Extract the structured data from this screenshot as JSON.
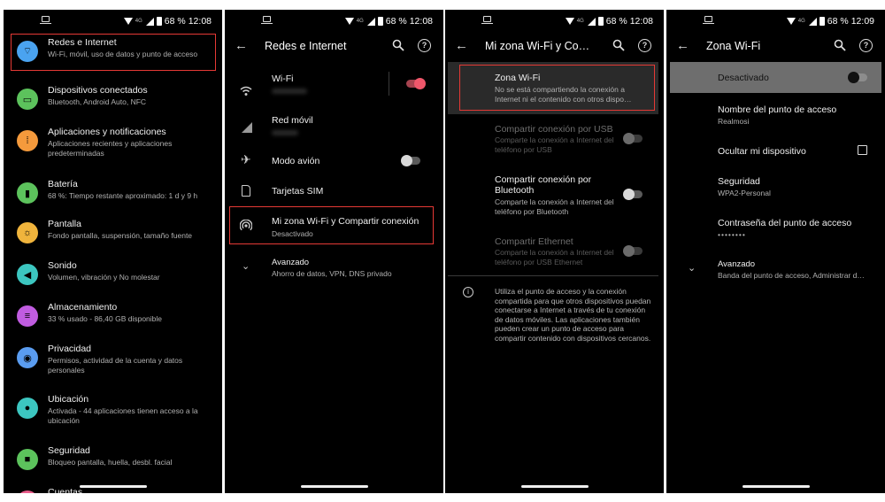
{
  "status": {
    "network": "4G",
    "battery": "68 %",
    "times": [
      "12:08",
      "12:08",
      "12:08",
      "12:09"
    ]
  },
  "screen1": {
    "items": [
      {
        "title": "Redes e Internet",
        "sub": "Wi-Fi, móvil, uso de datos y punto de acceso",
        "color": "#4aa3f0",
        "icon": "wifi-icon"
      },
      {
        "title": "Dispositivos conectados",
        "sub": "Bluetooth, Android Auto, NFC",
        "color": "#5cc25c",
        "icon": "devices-icon"
      },
      {
        "title": "Aplicaciones y notificaciones",
        "sub": "Aplicaciones recientes y aplicaciones predeterminadas",
        "color": "#f59a3c",
        "icon": "apps-icon"
      },
      {
        "title": "Batería",
        "sub": "68 %: Tiempo restante aproximado: 1 d y 9 h",
        "color": "#5cc25c",
        "icon": "battery-icon"
      },
      {
        "title": "Pantalla",
        "sub": "Fondo pantalla, suspensión, tamaño fuente",
        "color": "#f0b43c",
        "icon": "display-icon"
      },
      {
        "title": "Sonido",
        "sub": "Volumen, vibración y No molestar",
        "color": "#3cc6c0",
        "icon": "sound-icon"
      },
      {
        "title": "Almacenamiento",
        "sub": "33 % usado - 86,40 GB disponible",
        "color": "#c05ce0",
        "icon": "storage-icon"
      },
      {
        "title": "Privacidad",
        "sub": "Permisos, actividad de la cuenta y datos personales",
        "color": "#5a9cf0",
        "icon": "privacy-icon"
      },
      {
        "title": "Ubicación",
        "sub": "Activada - 44 aplicaciones tienen acceso a la ubicación",
        "color": "#3cc6c0",
        "icon": "location-icon"
      },
      {
        "title": "Seguridad",
        "sub": "Bloqueo pantalla, huella, desbl. facial",
        "color": "#5cc25c",
        "icon": "lock-icon"
      },
      {
        "title": "Cuentas",
        "sub": "",
        "color": "#e85c8a",
        "icon": "accounts-icon"
      }
    ]
  },
  "screen2": {
    "title": "Redes e Internet",
    "wifi": "Wi-Fi",
    "wifi_on": true,
    "mobile": "Red móvil",
    "airplane": "Modo avión",
    "sim": "Tarjetas SIM",
    "hotspot_title": "Mi zona Wi-Fi y Compartir conexión",
    "hotspot_sub": "Desactivado",
    "advanced_title": "Avanzado",
    "advanced_sub": "Ahorro de datos, VPN, DNS privado"
  },
  "screen3": {
    "title": "Mi zona Wi-Fi y Co…",
    "zone_title": "Zona Wi-Fi",
    "zone_sub": "No se está compartiendo la conexión a Internet ni el contenido con otros dispo…",
    "usb_title": "Compartir conexión por USB",
    "usb_sub": "Comparte la conexión a Internet del teléfono por USB",
    "bt_title": "Compartir conexión por Bluetooth",
    "bt_sub": "Comparte la conexión a Internet del teléfono por Bluetooth",
    "eth_title": "Compartir Ethernet",
    "eth_sub": "Comparte la conexión a Internet del teléfono por USB Ethernet",
    "info": "Utiliza el punto de acceso y la conexión compartida para que otros dispositivos puedan conectarse a Internet a través de tu conexión de datos móviles. Las aplicaciones también pueden crear un punto de acceso para compartir contenido con dispositivos cercanos."
  },
  "screen4": {
    "title": "Zona Wi-Fi",
    "state": "Desactivado",
    "name_title": "Nombre del punto de acceso",
    "name_value": "Realmosi",
    "hide": "Ocultar mi dispositivo",
    "security_title": "Seguridad",
    "security_value": "WPA2-Personal",
    "password_title": "Contraseña del punto de acceso",
    "password_value": "••••••••",
    "advanced_title": "Avanzado",
    "advanced_sub": "Banda del punto de acceso, Administrar d…"
  }
}
